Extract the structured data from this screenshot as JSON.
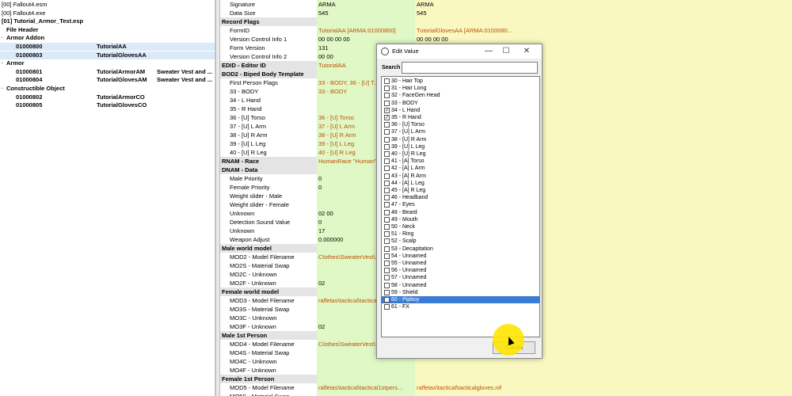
{
  "tree": {
    "rows": [
      {
        "t": "+",
        "c1": "[00] Fallout4.esm",
        "c2": "",
        "c3": ""
      },
      {
        "t": "",
        "c1": "[00] Fallout4.exe",
        "c2": "",
        "c3": ""
      },
      {
        "t": "−",
        "c1": "[01] Tutorial_Armor_Test.esp",
        "c2": "",
        "c3": ""
      },
      {
        "t": "",
        "c1": "File Header",
        "c2": "",
        "c3": ""
      },
      {
        "t": "−",
        "c1": "Armor Addon",
        "c2": "",
        "c3": ""
      },
      {
        "t": "",
        "c1": "01000800",
        "c2": "TutorialAA",
        "c3": ""
      },
      {
        "t": "",
        "c1": "01000803",
        "c2": "TutorialGlovesAA",
        "c3": ""
      },
      {
        "t": "−",
        "c1": "Armor",
        "c2": "",
        "c3": ""
      },
      {
        "t": "",
        "c1": "01000801",
        "c2": "TutorialArmorAM",
        "c3": "Sweater Vest and ..."
      },
      {
        "t": "",
        "c1": "01000804",
        "c2": "TutorialGlovesAM",
        "c3": "Sweater Vest and ..."
      },
      {
        "t": "−",
        "c1": "Constructible Object",
        "c2": "",
        "c3": ""
      },
      {
        "t": "",
        "c1": "01000802",
        "c2": "TutorialArmorCO",
        "c3": ""
      },
      {
        "t": "",
        "c1": "01000805",
        "c2": "TutorialGlovesCO",
        "c3": ""
      }
    ]
  },
  "grid": {
    "rows": [
      {
        "c1": "Signature",
        "c2": "ARMA",
        "c3": "ARMA"
      },
      {
        "c1": "Data Size",
        "c2": "545",
        "c3": "545"
      },
      {
        "c1": "Record Flags",
        "c2": "",
        "c3": "",
        "h": true
      },
      {
        "c1": "FormID",
        "c2": "TutorialAA [ARMA:01000800]",
        "c3": "TutorialGlovesAA [ARMA:0100080..."
      },
      {
        "c1": "Version Control Info 1",
        "c2": "00 00 00 00",
        "c3": "00 00 00 00"
      },
      {
        "c1": "Form Version",
        "c2": "131",
        "c3": "131"
      },
      {
        "c1": "Version Control Info 2",
        "c2": "00 00",
        "c3": "00 00"
      },
      {
        "c1": "EDID - Editor ID",
        "c2": "TutorialAA",
        "c3": "TutorialGlovesAA",
        "h": true
      },
      {
        "c1": "BOD2 - Biped Body Template",
        "c2": "",
        "c3": "",
        "h": true
      },
      {
        "c1": "First Person Flags",
        "c2": "33 - BODY, 36 - [U] T...",
        "c3": "34 - L Hand, 35 - R Hand"
      },
      {
        "c1": "33 - BODY",
        "c2": "33 - BODY",
        "c3": ""
      },
      {
        "c1": "34 - L Hand",
        "c2": "",
        "c3": "34 - L Hand"
      },
      {
        "c1": "35 - R Hand",
        "c2": "",
        "c3": "35 - R Hand"
      },
      {
        "c1": "36 - [U] Torso",
        "c2": "36 - [U] Torso",
        "c3": ""
      },
      {
        "c1": "37 - [U] L Arm",
        "c2": "37 - [U] L Arm",
        "c3": ""
      },
      {
        "c1": "38 - [U] R Arm",
        "c2": "38 - [U] R Arm",
        "c3": ""
      },
      {
        "c1": "39 - [U] L Leg",
        "c2": "39 - [U] L Leg",
        "c3": ""
      },
      {
        "c1": "40 - [U] R Leg",
        "c2": "40 - [U] R Leg",
        "c3": ""
      },
      {
        "c1": "RNAM - Race",
        "c2": "HumanRace \"Human\" [RA...",
        "c3": "HumanRace \"Human\" [RACE:000...",
        "h": true
      },
      {
        "c1": "DNAM - Data",
        "c2": "",
        "c3": "",
        "h": true
      },
      {
        "c1": "Male Priority",
        "c2": "0",
        "c3": "0"
      },
      {
        "c1": "Female Priority",
        "c2": "0",
        "c3": "0"
      },
      {
        "c1": "Weight slider - Male",
        "c2": "",
        "c3": ""
      },
      {
        "c1": "Weight slider - Female",
        "c2": "",
        "c3": ""
      },
      {
        "c1": "Unknown",
        "c2": "02 00",
        "c3": "02 00"
      },
      {
        "c1": "Detection Sound Value",
        "c2": "0",
        "c3": "0"
      },
      {
        "c1": "Unknown",
        "c2": "17",
        "c3": "17"
      },
      {
        "c1": "Weapon Adjust",
        "c2": "0.000000",
        "c3": "0.000000"
      },
      {
        "c1": "Male world model",
        "c2": "",
        "c3": "",
        "h": true
      },
      {
        "c1": "MOD2 - Model Filename",
        "c2": "Clothes\\SweaterVest\\...",
        "c3": "ralfetas\\tactical\\tacticalgloves.nif"
      },
      {
        "c1": "MO2S - Material Swap",
        "c2": "",
        "c3": ""
      },
      {
        "c1": "MO2C - Unknown",
        "c2": "",
        "c3": ""
      },
      {
        "c1": "MO2F - Unknown",
        "c2": "02",
        "c3": "02"
      },
      {
        "c1": "Female world model",
        "c2": "",
        "c3": "",
        "h": true
      },
      {
        "c1": "MOD3 - Model Filename",
        "c2": "ralfetas\\tactical\\tactica...",
        "c3": "ralfetas\\tactical\\tacticalgloves.nif"
      },
      {
        "c1": "MO3S - Material Swap",
        "c2": "",
        "c3": ""
      },
      {
        "c1": "MO3C - Unknown",
        "c2": "",
        "c3": ""
      },
      {
        "c1": "MO3F - Unknown",
        "c2": "02",
        "c3": "02"
      },
      {
        "c1": "Male 1st Person",
        "c2": "",
        "c3": "",
        "h": true
      },
      {
        "c1": "MOD4 - Model Filename",
        "c2": "Clothes\\SweaterVest\\1stP...",
        "c3": "ralfetas\\tactical\\tacticalgloves..."
      },
      {
        "c1": "MO4S - Material Swap",
        "c2": "",
        "c3": ""
      },
      {
        "c1": "MO4C - Unknown",
        "c2": "",
        "c3": ""
      },
      {
        "c1": "MO4F - Unknown",
        "c2": "",
        "c3": ""
      },
      {
        "c1": "Female 1st Person",
        "c2": "",
        "c3": "",
        "h": true
      },
      {
        "c1": "MOD5 - Model Filename",
        "c2": "ralfetas\\tactical\\tactical1stpers...",
        "c3": "ralfetas\\tactical\\tacticalgloves.nif"
      },
      {
        "c1": "MO5S - Material Swap",
        "c2": "",
        "c3": ""
      }
    ]
  },
  "dialog": {
    "title": "Edit Value",
    "minimize": "—",
    "maximize": "☐",
    "close": "✕",
    "search_label": "Search",
    "search_value": "",
    "cancel_label": "Cancel",
    "ok_label": "OK",
    "items": [
      {
        "label": "30 - Hair Top",
        "checked": false
      },
      {
        "label": "31 - Hair Long",
        "checked": false
      },
      {
        "label": "32 - FaceGen Head",
        "checked": false
      },
      {
        "label": "33 - BODY",
        "checked": false
      },
      {
        "label": "34 - L Hand",
        "checked": true
      },
      {
        "label": "35 - R Hand",
        "checked": true
      },
      {
        "label": "36 - [U] Torso",
        "checked": false
      },
      {
        "label": "37 - [U] L Arm",
        "checked": false
      },
      {
        "label": "38 - [U] R Arm",
        "checked": false
      },
      {
        "label": "39 - [U] L Leg",
        "checked": false
      },
      {
        "label": "40 - [U] R Leg",
        "checked": false
      },
      {
        "label": "41 - [A] Torso",
        "checked": false
      },
      {
        "label": "42 - [A] L Arm",
        "checked": false
      },
      {
        "label": "43 - [A] R Arm",
        "checked": false
      },
      {
        "label": "44 - [A] L Leg",
        "checked": false
      },
      {
        "label": "45 - [A] R Leg",
        "checked": false
      },
      {
        "label": "46 - Headband",
        "checked": false
      },
      {
        "label": "47 - Eyes",
        "checked": false
      },
      {
        "label": "48 - Beard",
        "checked": false
      },
      {
        "label": "49 - Mouth",
        "checked": false
      },
      {
        "label": "50 - Neck",
        "checked": false
      },
      {
        "label": "51 - Ring",
        "checked": false
      },
      {
        "label": "52 - Scalp",
        "checked": false
      },
      {
        "label": "53 - Decapitation",
        "checked": false
      },
      {
        "label": "54 - Unnamed",
        "checked": false
      },
      {
        "label": "55 - Unnamed",
        "checked": false
      },
      {
        "label": "56 - Unnamed",
        "checked": false
      },
      {
        "label": "57 - Unnamed",
        "checked": false
      },
      {
        "label": "58 - Unnamed",
        "checked": false
      },
      {
        "label": "59 - Shield",
        "checked": false
      },
      {
        "label": "60 - Pipboy",
        "checked": false,
        "selected": true
      },
      {
        "label": "61 - FX",
        "checked": false
      }
    ]
  }
}
